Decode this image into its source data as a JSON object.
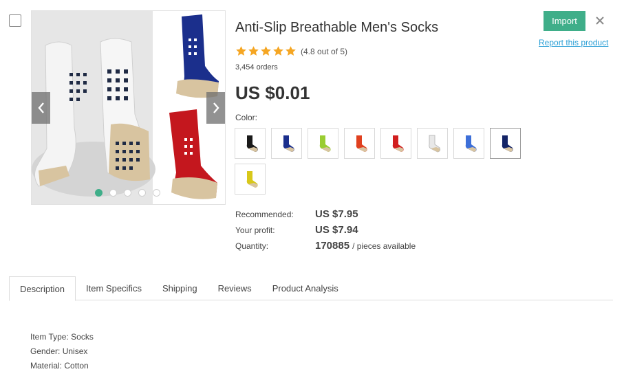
{
  "product": {
    "title": "Anti-Slip Breathable Men's Socks",
    "rating_text": "(4.8 out of 5)",
    "stars": 5,
    "orders": "3,454 orders",
    "price": "US $0.01",
    "color_label": "Color:",
    "colors": [
      {
        "name": "black",
        "hex": "#1a1a1a"
      },
      {
        "name": "navy",
        "hex": "#1b2f8c"
      },
      {
        "name": "lime",
        "hex": "#9acd32"
      },
      {
        "name": "orange-red",
        "hex": "#e0401f"
      },
      {
        "name": "red",
        "hex": "#d11f1f"
      },
      {
        "name": "white",
        "hex": "#e8e8e8"
      },
      {
        "name": "blue",
        "hex": "#3d6fd8"
      },
      {
        "name": "dark-navy",
        "hex": "#142466"
      },
      {
        "name": "yellow",
        "hex": "#d8c81a"
      }
    ],
    "selected_color_index": 7
  },
  "gallery": {
    "slide_count": 5,
    "active_slide": 0
  },
  "specs": {
    "recommended_label": "Recommended:",
    "recommended_value": "US $7.95",
    "profit_label": "Your profit:",
    "profit_value": "US $7.94",
    "quantity_label": "Quantity:",
    "quantity_value": "170885",
    "quantity_suffix": "/ pieces available"
  },
  "actions": {
    "import_label": "Import",
    "report_label": "Report this product"
  },
  "tabs": [
    {
      "label": "Description",
      "active": true
    },
    {
      "label": "Item Specifics",
      "active": false
    },
    {
      "label": "Shipping",
      "active": false
    },
    {
      "label": "Reviews",
      "active": false
    },
    {
      "label": "Product Analysis",
      "active": false
    }
  ],
  "description": [
    "Item Type: Socks",
    "Gender: Unisex",
    "Material: Cotton"
  ],
  "colors": {
    "accent": "#3fae89",
    "link": "#2b9fd6",
    "star": "#f5a623"
  }
}
